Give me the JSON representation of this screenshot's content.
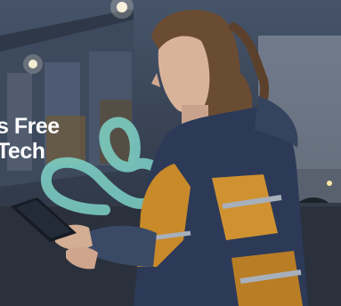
{
  "headline": {
    "line1": "s Free",
    "line2": "Tech"
  },
  "logo": {
    "icon": "infinity-loop-logo",
    "color": "#7fd3c8"
  },
  "colors": {
    "jacket_yellow": "#c98a2a",
    "jacket_navy": "#2c3a58",
    "sky": "#46546a"
  }
}
